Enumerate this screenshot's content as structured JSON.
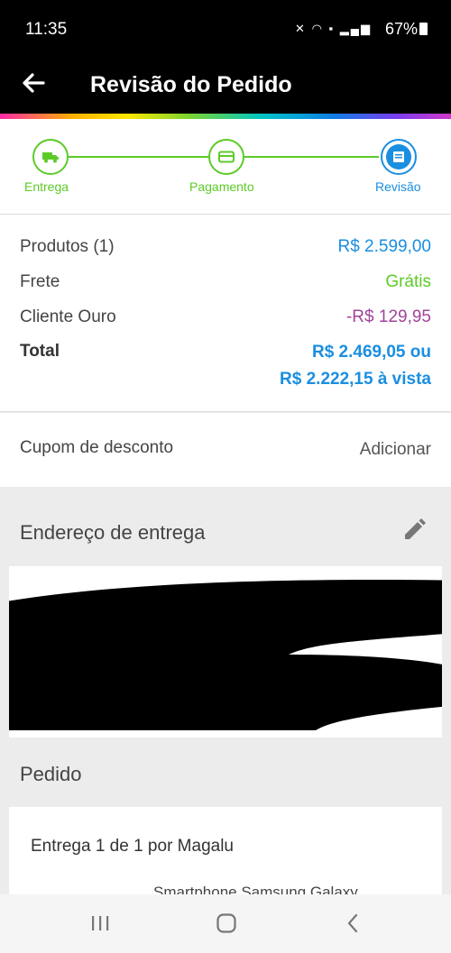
{
  "status_bar": {
    "time": "11:35",
    "icons": [
      "mute-icon",
      "wifi-icon",
      "volte-icon",
      "signal-icon"
    ],
    "battery": "67%"
  },
  "app_bar": {
    "title": "Revisão do Pedido"
  },
  "stepper": {
    "steps": [
      {
        "label": "Entrega",
        "state": "done",
        "icon": "truck-icon"
      },
      {
        "label": "Pagamento",
        "state": "done",
        "icon": "card-icon"
      },
      {
        "label": "Revisão",
        "state": "current",
        "icon": "review-icon"
      }
    ],
    "colors": {
      "done": "#5ccb28",
      "current": "#1a8ee0"
    }
  },
  "summary": {
    "products_label": "Produtos (1)",
    "products_value": "R$ 2.599,00",
    "shipping_label": "Frete",
    "shipping_value": "Grátis",
    "gold_label": "Cliente Ouro",
    "gold_value": "-R$ 129,95",
    "total_label": "Total",
    "total_value_line1": "R$ 2.469,05 ou",
    "total_value_line2": "R$ 2.222,15 à vista",
    "colors": {
      "price": "#1a8ee0",
      "free": "#5ccb28",
      "discount": "#a0449a"
    }
  },
  "coupon": {
    "label": "Cupom de desconto",
    "action": "Adicionar"
  },
  "address": {
    "title": "Endereço de entrega"
  },
  "order": {
    "title": "Pedido",
    "delivery": "Entrega 1 de 1 por Magalu",
    "product": "Smartphone Samsung Galaxy"
  },
  "nav": {
    "buttons": [
      "recents-icon",
      "home-icon",
      "back-icon"
    ]
  }
}
